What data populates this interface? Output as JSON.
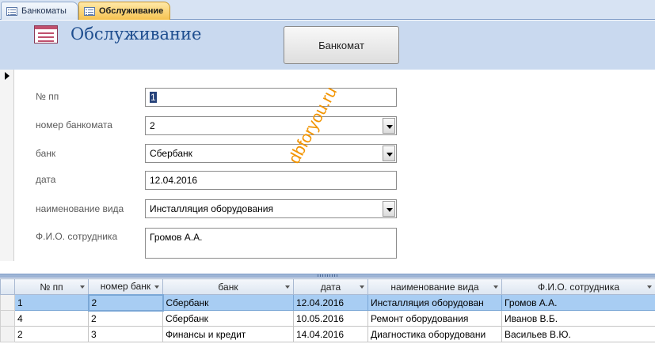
{
  "tabs": [
    {
      "label": "Банкоматы",
      "active": false
    },
    {
      "label": "Обслуживание",
      "active": true
    }
  ],
  "form": {
    "title": "Обслуживание",
    "atm_button_label": "Банкомат"
  },
  "fields": {
    "num": {
      "label": "№ пп",
      "value": "1"
    },
    "atm_number": {
      "label": "номер банкомата",
      "value": "2"
    },
    "bank": {
      "label": "банк",
      "value": "Сбербанк"
    },
    "date": {
      "label": "дата",
      "value": "12.04.2016"
    },
    "type_name": {
      "label": "наименование вида",
      "value": "Инсталляция оборудования"
    },
    "employee": {
      "label": "Ф.И.О. сотрудника",
      "value": "Громов А.А."
    }
  },
  "watermark": "dbforyou.ru",
  "table": {
    "columns": [
      "№ пп",
      "номер банк",
      "банк",
      "дата",
      "наименование вида",
      "Ф.И.О. сотрудника"
    ],
    "rows": [
      [
        "1",
        "2",
        "Сбербанк",
        "12.04.2016",
        "Инсталляция оборудован",
        "Громов А.А."
      ],
      [
        "4",
        "2",
        "Сбербанк",
        "10.05.2016",
        "Ремонт оборудования",
        "Иванов В.Б."
      ],
      [
        "2",
        "3",
        "Финансы и кредит",
        "14.04.2016",
        "Диагностика оборудовани",
        "Васильев В.Ю."
      ]
    ],
    "selected_row": 0
  },
  "colors": {
    "header_bg": "#c9d9ef",
    "title": "#1f4e8f",
    "active_tab": "#f6c250",
    "selected_row": "#a8cdf3",
    "watermark": "#f29400"
  }
}
